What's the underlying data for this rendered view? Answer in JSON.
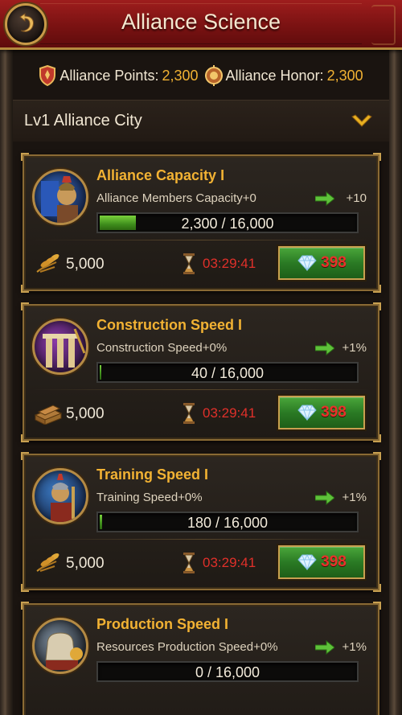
{
  "header": {
    "title": "Alliance Science"
  },
  "stats": {
    "points_label": "Alliance Points:",
    "points_value": "2,300",
    "honor_label": "Alliance Honor:",
    "honor_value": "2,300"
  },
  "city": {
    "label": "Lv1 Alliance City"
  },
  "cards": [
    {
      "title": "Alliance Capacity  I",
      "desc": "Alliance Members Capacity+0",
      "next": "+10",
      "progress": "2,300 / 16,000",
      "progress_fraction": 0.144,
      "cost": "5,000",
      "cost_icon": "wheat-icon",
      "timer": "03:29:41",
      "gems": "398"
    },
    {
      "title": "Construction Speed  I",
      "desc": "Construction Speed+0%",
      "next": "+1%",
      "progress": "40 / 16,000",
      "progress_fraction": 0.0025,
      "cost": "5,000",
      "cost_icon": "wood-icon",
      "timer": "03:29:41",
      "gems": "398"
    },
    {
      "title": "Training Speed  I",
      "desc": "Training Speed+0%",
      "next": "+1%",
      "progress": "180 / 16,000",
      "progress_fraction": 0.011,
      "cost": "5,000",
      "cost_icon": "wheat-icon",
      "timer": "03:29:41",
      "gems": "398"
    },
    {
      "title": "Production Speed  I",
      "desc": "Resources Production Speed+0%",
      "next": "+1%",
      "progress": "0 / 16,000",
      "progress_fraction": 0,
      "cost": "",
      "cost_icon": "",
      "timer": "",
      "gems": ""
    }
  ],
  "colors": {
    "accent_gold": "#f2b233",
    "timer_red": "#e0302a",
    "header_red": "#7a1212",
    "button_green": "#2a7a24"
  }
}
